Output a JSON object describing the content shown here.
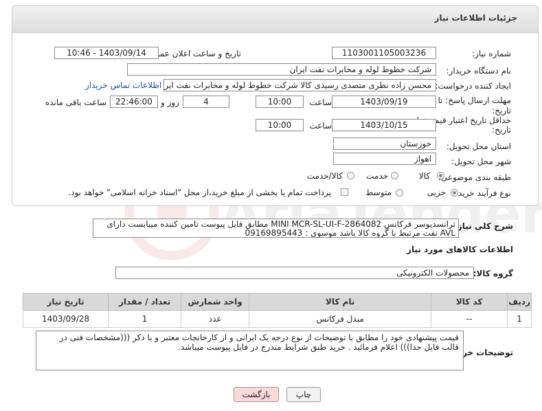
{
  "panel": {
    "title": "جزئیات اطلاعات نیاز"
  },
  "fields": {
    "need_number_label": "شماره نیاز:",
    "need_number": "1103001105003236",
    "announce_label": "تاریخ و ساعت اعلان عمومی:",
    "announce_value": "1403/09/14 - 10:46",
    "buyer_org_label": "نام دستگاه خریدار:",
    "buyer_org": "شرکت خطوط لوله و مخابرات نفت ایران",
    "creator_label": "ایجاد کننده درخواست:",
    "creator": "محسن زاده نظری متصدی رسیدی کالا شرکت خطوط لوله و مخابرات نفت ایران",
    "contact_link": "اطلاعات تماس خریدار",
    "deadline_label_1": "مهلت ارسال پاسخ: تا",
    "deadline_label_2": "تاریخ:",
    "deadline_date": "1403/09/19",
    "time_label": "ساعت",
    "deadline_time": "10:00",
    "days_value": "4",
    "days_label": "روز و",
    "remaining_time": "22:46:00",
    "remaining_label": "ساعت باقی مانده",
    "validity_label_1": "حداقل تاریخ اعتبار قیمت: تا",
    "validity_label_2": "تاریخ:",
    "validity_date": "1403/10/15",
    "validity_time_label": "ساعت",
    "validity_time": "10:00",
    "province_label": "استان محل تحویل:",
    "province": "خوزستان",
    "city_label": "شهر محل تحویل:",
    "city": "اهواز",
    "category_label": "طبقه بندی موضوعی:",
    "category_options": [
      "کالا",
      "خدمت",
      "کالا/خدمت"
    ],
    "category_selected": "کالا",
    "process_label": "نوع فرآیند خرید :",
    "process_options": [
      "جزیی",
      "متوسط"
    ],
    "process_selected": "جزیی",
    "payment_text": "پرداخت تمام یا بخشی از مبلغ خرید،از محل \"اسناد خزانه اسلامی\" خواهد بود."
  },
  "description": {
    "label": "شرح کلی نیاز:",
    "text": "ترانسدیوسر فرکانس MINI MCR-SL-UI-F-2864082 مطابق فایل پیوست تامین کننده میبایست دارای AVL نفت مرتبط با گروه کالا باشد موسوی : 09169895443"
  },
  "goods_info": {
    "title": "اطلاعات کالاهای مورد نیاز",
    "group_label": "گروه کالا:",
    "group_value": "محصولات الکترونیکی"
  },
  "table": {
    "headers": [
      "ردیف",
      "کد کالا",
      "نام کالا",
      "واحد شمارش",
      "تعداد / مقدار",
      "تاریخ نیاز"
    ],
    "rows": [
      [
        "1",
        "--",
        "مبدل فرکانس",
        "عدد",
        "1",
        "1403/09/28"
      ]
    ]
  },
  "buyer_notes": {
    "label": "توضیحات خریدار:",
    "text": "قیمت پیشنهادی خود را مطابق با توضیحات از نوع درجه یک ایرانی و از کارخانجات معتبر و با ذکر (((مشخصات فنی در قالب فایل جدا))) اعلام فرمائید . خرید طبق شرایط مندرج در فایل پیوست میباشد."
  },
  "buttons": {
    "print": "چاپ",
    "back": "بازگشت"
  },
  "colors": {
    "header_bg": "#e4e4e4",
    "link": "#1a4fb0",
    "back_button_bg": "#f9d9d9",
    "table_header_bg": "#d9d9d9"
  },
  "watermark_text": "AriaTender.neT"
}
